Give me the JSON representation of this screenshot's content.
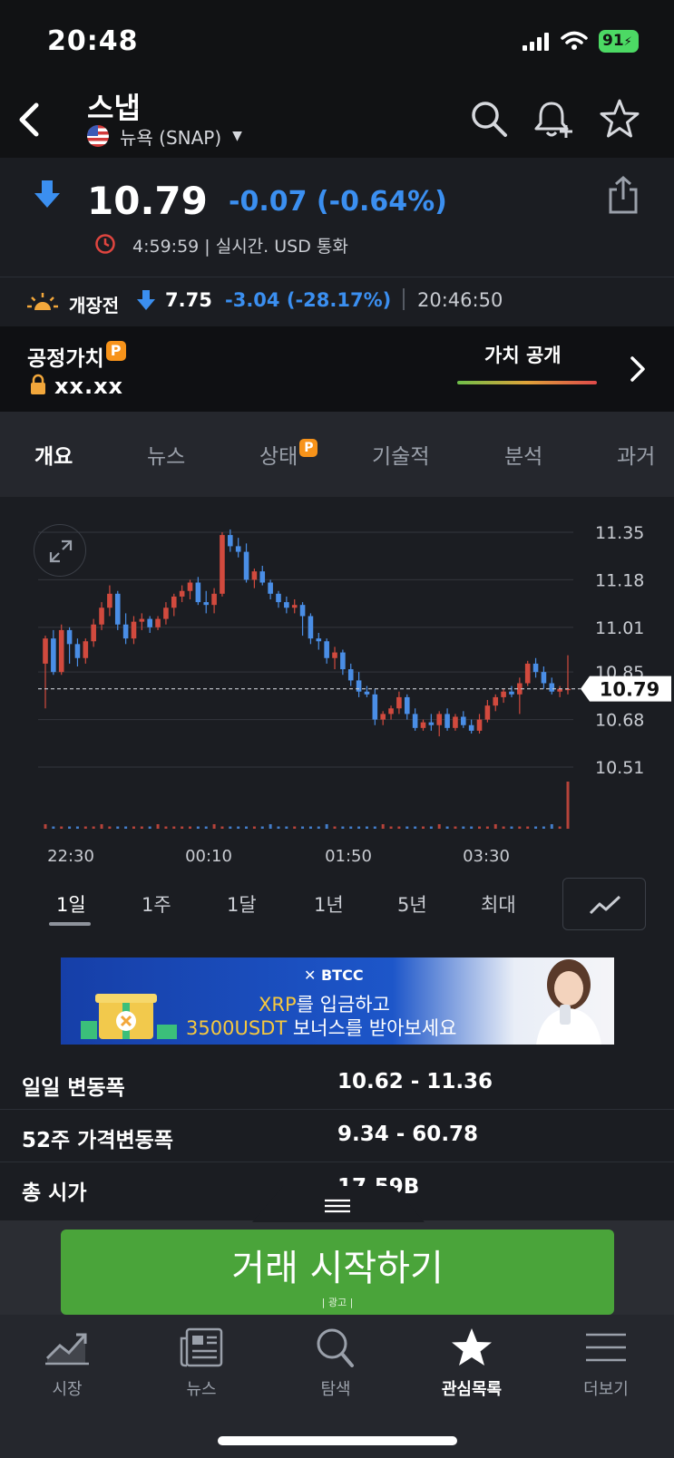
{
  "status_bar": {
    "time": "20:48",
    "battery": "91"
  },
  "header": {
    "stock_name": "스냅",
    "exchange": "뉴욕 (SNAP)"
  },
  "price": {
    "value": "10.79",
    "change": "-0.07 (-0.64%)",
    "time_info": "4:59:59 | 실시간. USD 통화",
    "direction": "down",
    "change_color": "#3b8ff0"
  },
  "premarket": {
    "label": "개장전",
    "price": "7.75",
    "change": "-3.04 (-28.17%)",
    "time": "20:46:50"
  },
  "fair_value": {
    "label": "공정가치",
    "badge": "P",
    "value": "xx.xx",
    "reveal_label": "가치 공개"
  },
  "tabs": [
    {
      "label": "개요",
      "active": true
    },
    {
      "label": "뉴스"
    },
    {
      "label": "상태",
      "badge": "P"
    },
    {
      "label": "기술적"
    },
    {
      "label": "분석"
    },
    {
      "label": "과거"
    }
  ],
  "chart_data": {
    "type": "candlestick",
    "x_ticks": [
      "22:30",
      "00:10",
      "01:50",
      "03:30"
    ],
    "y_ticks": [
      11.35,
      11.18,
      11.01,
      10.85,
      10.68,
      10.51
    ],
    "ylim": [
      10.51,
      11.35
    ],
    "current_price": 10.79,
    "current_price_label": "10.79",
    "up_color": "#d14a3e",
    "down_color": "#4a8ee6",
    "candles": [
      [
        10.88,
        10.98,
        10.72,
        10.97
      ],
      [
        10.97,
        11.0,
        10.84,
        10.85
      ],
      [
        10.85,
        11.02,
        10.84,
        11.0
      ],
      [
        11.0,
        11.01,
        10.88,
        10.95
      ],
      [
        10.95,
        10.97,
        10.87,
        10.9
      ],
      [
        10.9,
        10.97,
        10.88,
        10.96
      ],
      [
        10.96,
        11.04,
        10.94,
        11.02
      ],
      [
        11.02,
        11.1,
        11.0,
        11.08
      ],
      [
        11.08,
        11.16,
        11.05,
        11.13
      ],
      [
        11.13,
        11.14,
        11.0,
        11.02
      ],
      [
        11.02,
        11.06,
        10.95,
        10.97
      ],
      [
        10.97,
        11.05,
        10.95,
        11.03
      ],
      [
        11.03,
        11.06,
        11.0,
        11.04
      ],
      [
        11.04,
        11.05,
        10.99,
        11.01
      ],
      [
        11.01,
        11.05,
        11.0,
        11.04
      ],
      [
        11.04,
        11.1,
        11.02,
        11.08
      ],
      [
        11.08,
        11.13,
        11.05,
        11.12
      ],
      [
        11.12,
        11.16,
        11.1,
        11.14
      ],
      [
        11.14,
        11.18,
        11.11,
        11.17
      ],
      [
        11.17,
        11.19,
        11.09,
        11.1
      ],
      [
        11.1,
        11.14,
        11.06,
        11.09
      ],
      [
        11.09,
        11.15,
        11.06,
        11.13
      ],
      [
        11.13,
        11.35,
        11.12,
        11.34
      ],
      [
        11.34,
        11.36,
        11.28,
        11.3
      ],
      [
        11.3,
        11.33,
        11.26,
        11.28
      ],
      [
        11.28,
        11.31,
        11.17,
        11.18
      ],
      [
        11.18,
        11.22,
        11.15,
        11.21
      ],
      [
        11.21,
        11.23,
        11.16,
        11.17
      ],
      [
        11.17,
        11.18,
        11.11,
        11.13
      ],
      [
        11.13,
        11.14,
        11.08,
        11.1
      ],
      [
        11.1,
        11.12,
        11.06,
        11.08
      ],
      [
        11.08,
        11.11,
        11.06,
        11.09
      ],
      [
        11.09,
        11.1,
        10.98,
        11.05
      ],
      [
        11.05,
        11.06,
        10.95,
        10.97
      ],
      [
        10.97,
        10.99,
        10.93,
        10.96
      ],
      [
        10.96,
        10.97,
        10.88,
        10.9
      ],
      [
        10.9,
        10.94,
        10.86,
        10.92
      ],
      [
        10.92,
        10.93,
        10.84,
        10.86
      ],
      [
        10.86,
        10.88,
        10.8,
        10.82
      ],
      [
        10.82,
        10.85,
        10.76,
        10.78
      ],
      [
        10.78,
        10.8,
        10.76,
        10.77
      ],
      [
        10.77,
        10.79,
        10.66,
        10.68
      ],
      [
        10.68,
        10.71,
        10.66,
        10.7
      ],
      [
        10.7,
        10.73,
        10.68,
        10.72
      ],
      [
        10.72,
        10.78,
        10.7,
        10.76
      ],
      [
        10.76,
        10.77,
        10.68,
        10.7
      ],
      [
        10.7,
        10.72,
        10.64,
        10.65
      ],
      [
        10.65,
        10.68,
        10.64,
        10.67
      ],
      [
        10.67,
        10.7,
        10.64,
        10.66
      ],
      [
        10.66,
        10.71,
        10.62,
        10.7
      ],
      [
        10.7,
        10.72,
        10.64,
        10.65
      ],
      [
        10.65,
        10.7,
        10.64,
        10.69
      ],
      [
        10.69,
        10.71,
        10.65,
        10.66
      ],
      [
        10.66,
        10.68,
        10.63,
        10.64
      ],
      [
        10.64,
        10.7,
        10.63,
        10.68
      ],
      [
        10.68,
        10.75,
        10.67,
        10.73
      ],
      [
        10.73,
        10.77,
        10.71,
        10.76
      ],
      [
        10.76,
        10.79,
        10.74,
        10.78
      ],
      [
        10.78,
        10.8,
        10.76,
        10.77
      ],
      [
        10.77,
        10.83,
        10.7,
        10.81
      ],
      [
        10.81,
        10.89,
        10.8,
        10.88
      ],
      [
        10.88,
        10.9,
        10.83,
        10.85
      ],
      [
        10.85,
        10.87,
        10.79,
        10.81
      ],
      [
        10.81,
        10.83,
        10.77,
        10.78
      ],
      [
        10.78,
        10.8,
        10.76,
        10.79
      ],
      [
        10.79,
        10.91,
        10.77,
        10.79
      ]
    ]
  },
  "ranges": [
    {
      "label": "1일",
      "active": true
    },
    {
      "label": "1주"
    },
    {
      "label": "1달"
    },
    {
      "label": "1년"
    },
    {
      "label": "5년"
    },
    {
      "label": "최대"
    }
  ],
  "ad": {
    "brand": "BTCC",
    "line1_accent": "XRP",
    "line1_rest": "를 입금하고",
    "line2_accent": "3500USDT",
    "line2_rest": " 보너스를 받아보세요"
  },
  "stats": [
    {
      "label": "일일 변동폭",
      "value": "10.62 - 11.36"
    },
    {
      "label": "52주 가격변동폭",
      "value": "9.34 - 60.78"
    },
    {
      "label": "총 시가",
      "value": "17.59B"
    }
  ],
  "trade": {
    "label": "거래 시작하기",
    "ad_tag": "| 광고 |"
  },
  "bottom_nav": [
    {
      "label": "시장",
      "icon": "chart-icon"
    },
    {
      "label": "뉴스",
      "icon": "newspaper-icon"
    },
    {
      "label": "탐색",
      "icon": "search-icon"
    },
    {
      "label": "관심목록",
      "icon": "star-icon",
      "active": true
    },
    {
      "label": "더보기",
      "icon": "menu-icon"
    }
  ]
}
